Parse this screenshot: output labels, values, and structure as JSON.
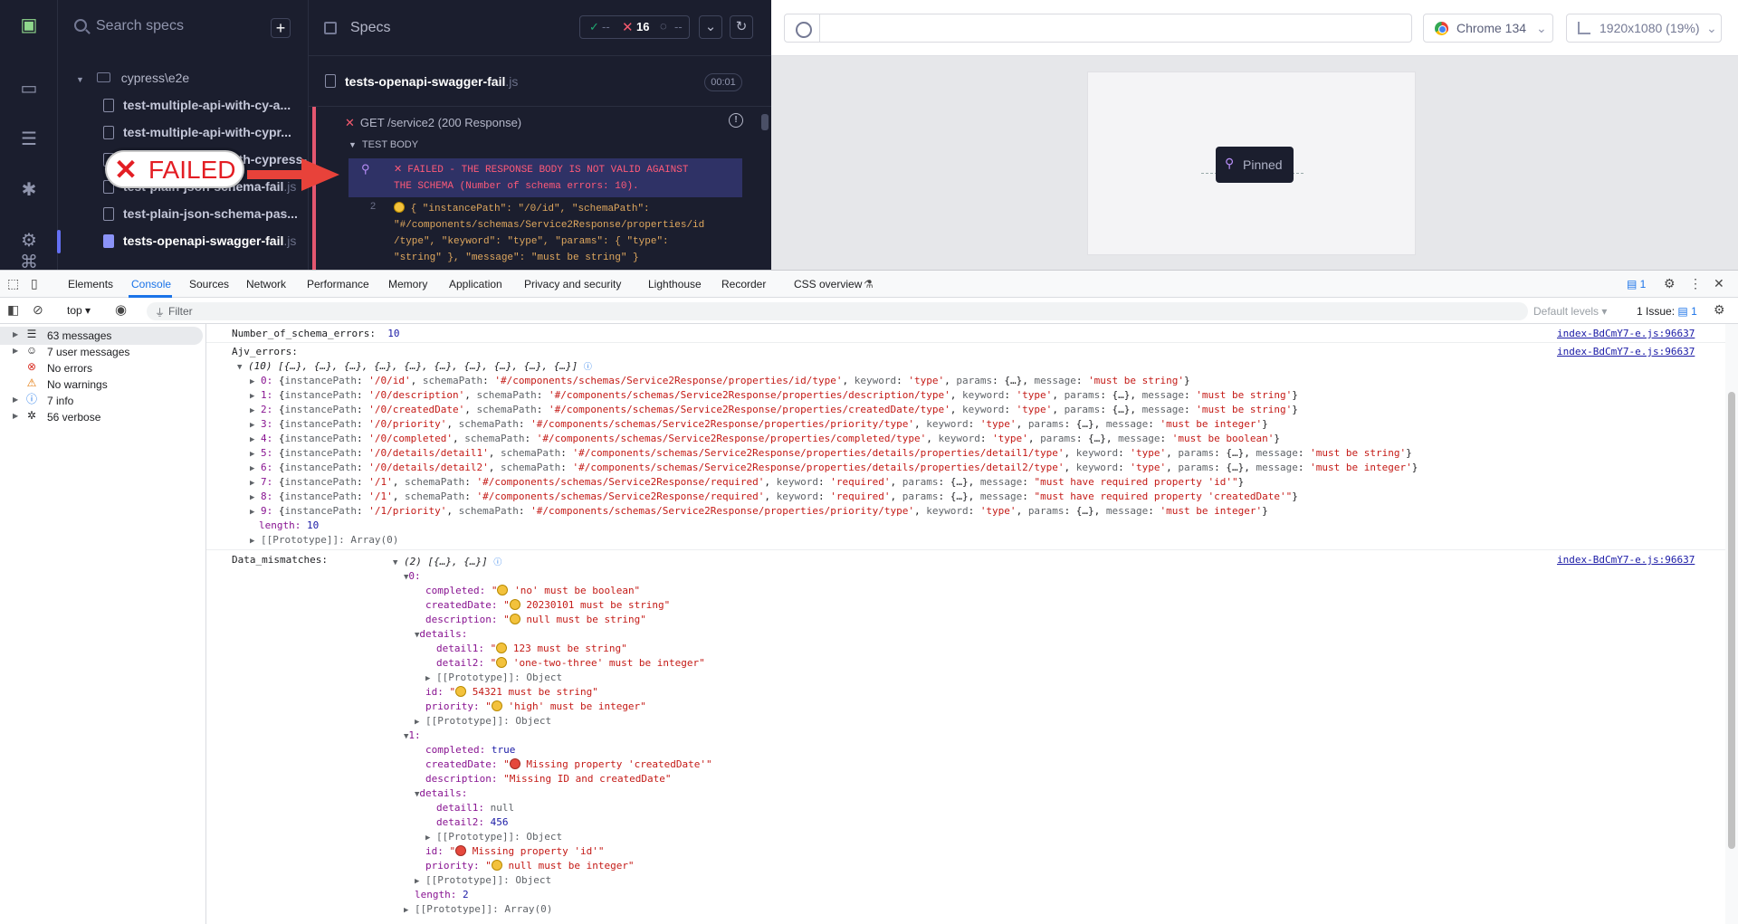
{
  "cypress": {
    "search_placeholder": "Search specs",
    "folder": "cypress\\e2e",
    "specs": [
      {
        "name": "test-multiple-api-with-cy-a...",
        "ext": ""
      },
      {
        "name": "test-multiple-api-with-cypr...",
        "ext": ""
      },
      {
        "name": "test-multiple-api-with-cypress-...",
        "ext": ""
      },
      {
        "name": "test-plain-json-schema-fail",
        "ext": ".js"
      },
      {
        "name": "test-plain-json-schema-pas...",
        "ext": ""
      },
      {
        "name": "tests-openapi-swagger-fail",
        "ext": ".js"
      }
    ],
    "runner_title": "Specs",
    "stats": {
      "passed": "--",
      "failed": "16",
      "pending": "--"
    },
    "spec_name": "tests-openapi-swagger-fail",
    "spec_ext": ".js",
    "duration": "00:01",
    "test_title": "GET /service2 (200 Response)",
    "test_body_label": "TEST BODY",
    "fail_line_1": "FAILED - THE RESPONSE BODY IS NOT VALID AGAINST",
    "fail_line_2": "THE SCHEMA (Number of schema errors: 10).",
    "cmd_num": "2",
    "cmd_line_1": "{ \"instancePath\": \"/0/id\", \"schemaPath\":",
    "cmd_line_2": "\"#/components/schemas/Service2Response/properties/id",
    "cmd_line_3": "/type\", \"keyword\": \"type\", \"params\": { \"type\":",
    "cmd_line_4": "\"string\" }, \"message\": \"must be string\" }",
    "badge_label": "FAILED"
  },
  "browser": {
    "name": "Chrome 134",
    "viewport": "1920x1080 (19%)",
    "pinned_label": "Pinned"
  },
  "devtools": {
    "tabs": [
      "Elements",
      "Console",
      "Sources",
      "Network",
      "Performance",
      "Memory",
      "Application",
      "Privacy and security",
      "Lighthouse",
      "Recorder",
      "CSS overview"
    ],
    "badge_count": "1",
    "context": "top",
    "filter_placeholder": "Filter",
    "levels": "Default levels",
    "issues_label": "1 Issue:",
    "issues_count": "1",
    "sidebar": [
      {
        "label": "63 messages",
        "icon": "list-icon"
      },
      {
        "label": "7 user messages",
        "icon": "user-icon"
      },
      {
        "label": "No errors",
        "icon": "error-icon"
      },
      {
        "label": "No warnings",
        "icon": "warning-icon"
      },
      {
        "label": "7 info",
        "icon": "info-icon"
      },
      {
        "label": "56 verbose",
        "icon": "bug-icon"
      }
    ],
    "source_link": "index-BdCmY7-e.js:96637",
    "console": {
      "schema_errors_key": "Number_of_schema_errors:",
      "schema_errors_val": "10",
      "ajv_key": "Ajv_errors:",
      "ajv_summary": "(10) [{…}, {…}, {…}, {…}, {…}, {…}, {…}, {…}, {…}, {…}]",
      "ajv_items": [
        {
          "i": "0",
          "ip": "'/0/id'",
          "sp": "'#/components/schemas/Service2Response/properties/id/type'",
          "kw": "'type'",
          "msg": "'must be string'"
        },
        {
          "i": "1",
          "ip": "'/0/description'",
          "sp": "'#/components/schemas/Service2Response/properties/description/type'",
          "kw": "'type'",
          "msg": "'must be string'"
        },
        {
          "i": "2",
          "ip": "'/0/createdDate'",
          "sp": "'#/components/schemas/Service2Response/properties/createdDate/type'",
          "kw": "'type'",
          "msg": "'must be string'"
        },
        {
          "i": "3",
          "ip": "'/0/priority'",
          "sp": "'#/components/schemas/Service2Response/properties/priority/type'",
          "kw": "'type'",
          "msg": "'must be integer'"
        },
        {
          "i": "4",
          "ip": "'/0/completed'",
          "sp": "'#/components/schemas/Service2Response/properties/completed/type'",
          "kw": "'type'",
          "msg": "'must be boolean'"
        },
        {
          "i": "5",
          "ip": "'/0/details/detail1'",
          "sp": "'#/components/schemas/Service2Response/properties/details/properties/detail1/type'",
          "kw": "'type'",
          "msg": "'must be string'"
        },
        {
          "i": "6",
          "ip": "'/0/details/detail2'",
          "sp": "'#/components/schemas/Service2Response/properties/details/properties/detail2/type'",
          "kw": "'type'",
          "msg": "'must be integer'"
        },
        {
          "i": "7",
          "ip": "'/1'",
          "sp": "'#/components/schemas/Service2Response/required'",
          "kw": "'required'",
          "msg": "\"must have required property 'id'\""
        },
        {
          "i": "8",
          "ip": "'/1'",
          "sp": "'#/components/schemas/Service2Response/required'",
          "kw": "'required'",
          "msg": "\"must have required property 'createdDate'\""
        },
        {
          "i": "9",
          "ip": "'/1/priority'",
          "sp": "'#/components/schemas/Service2Response/properties/priority/type'",
          "kw": "'type'",
          "msg": "'must be integer'"
        }
      ],
      "length_key": "length:",
      "ajv_length": "10",
      "proto_array": "[[Prototype]]: Array(0)",
      "proto_object": "[[Prototype]]: Object",
      "mismatch_key": "Data_mismatches:",
      "mismatch_summary": "(2) [{…}, {…}]",
      "m0": {
        "completed": "'no' must be boolean\"",
        "createdDate": "20230101 must be string\"",
        "description": "null must be string\"",
        "detail1": "123 must be string\"",
        "detail2": "'one-two-three' must be integer\"",
        "id": "54321 must be string\"",
        "priority": "'high' must be integer\""
      },
      "m1": {
        "completed": "true",
        "createdDate": "Missing property 'createdDate'\"",
        "description": "\"Missing ID and createdDate\"",
        "detail1": "null",
        "detail2": "456",
        "id": "Missing property 'id'\"",
        "priority": "null must be integer\""
      },
      "m_length": "2"
    }
  }
}
